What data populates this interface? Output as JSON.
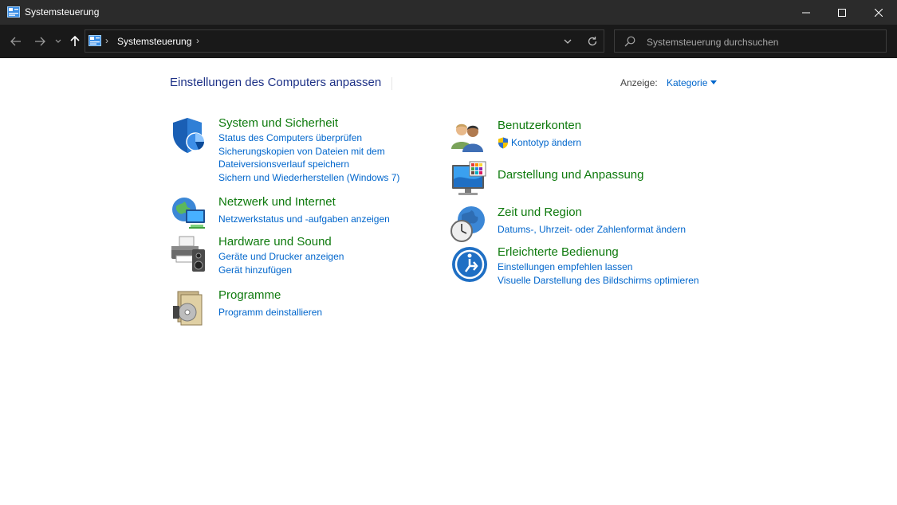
{
  "window": {
    "title": "Systemsteuerung"
  },
  "address_bar": {
    "breadcrumb": "Systemsteuerung",
    "separator": "›",
    "search_placeholder": "Systemsteuerung durchsuchen"
  },
  "page": {
    "title": "Einstellungen des Computers anpassen",
    "view_label": "Anzeige:",
    "view_value": "Kategorie"
  },
  "categories_left": [
    {
      "name": "System und Sicherheit",
      "icon": "shield-security-icon",
      "links": [
        "Status des Computers überprüfen",
        "Sicherungskopien von Dateien mit dem",
        "Dateiversionsverlauf speichern",
        "Sichern und Wiederherstellen (Windows 7)"
      ]
    },
    {
      "name": "Netzwerk und Internet",
      "icon": "network-globe-icon",
      "links": [
        "Netzwerkstatus und -aufgaben anzeigen"
      ]
    },
    {
      "name": "Hardware und Sound",
      "icon": "printer-speaker-icon",
      "links": [
        "Geräte und Drucker anzeigen",
        "Gerät hinzufügen"
      ]
    },
    {
      "name": "Programme",
      "icon": "programs-disc-icon",
      "links": [
        "Programm deinstallieren"
      ]
    }
  ],
  "categories_right": [
    {
      "name": "Benutzerkonten",
      "icon": "users-icon",
      "links": [
        "Kontotyp ändern"
      ]
    },
    {
      "name": "Darstellung und Anpassung",
      "icon": "monitor-palette-icon",
      "links": []
    },
    {
      "name": "Zeit und Region",
      "icon": "clock-globe-icon",
      "links": [
        "Datums-, Uhrzeit- oder Zahlenformat ändern"
      ]
    },
    {
      "name": "Erleichterte Bedienung",
      "icon": "accessibility-icon",
      "links": [
        "Einstellungen empfehlen lassen",
        "Visuelle Darstellung des Bildschirms optimieren"
      ]
    }
  ],
  "colors": {
    "titlebar": "#2b2b2b",
    "navbar": "#191919",
    "category_heading": "#0e7a0d",
    "link": "#0066cc",
    "page_title": "#1e3287"
  }
}
